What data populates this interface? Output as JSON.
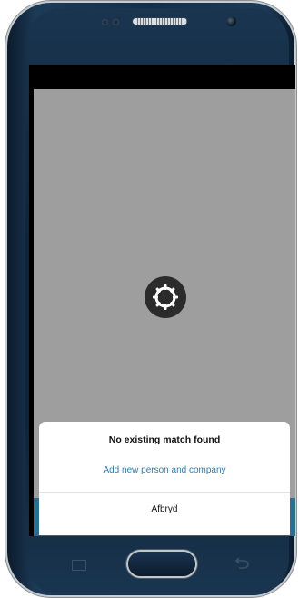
{
  "device": {
    "model_view": "android-phone-frame"
  },
  "dialog": {
    "title": "No existing match found",
    "primary_action": "Add new person and company",
    "cancel_action": "Afbryd"
  },
  "icons": {
    "spinner": "loading-gear-icon",
    "home": "home-button",
    "recent": "recent-apps-icon",
    "back": "back-icon"
  },
  "colors": {
    "overlay_gray": "#9e9e9e",
    "action_link": "#2d7cb0",
    "teal_bar": "#2b6f8f"
  }
}
